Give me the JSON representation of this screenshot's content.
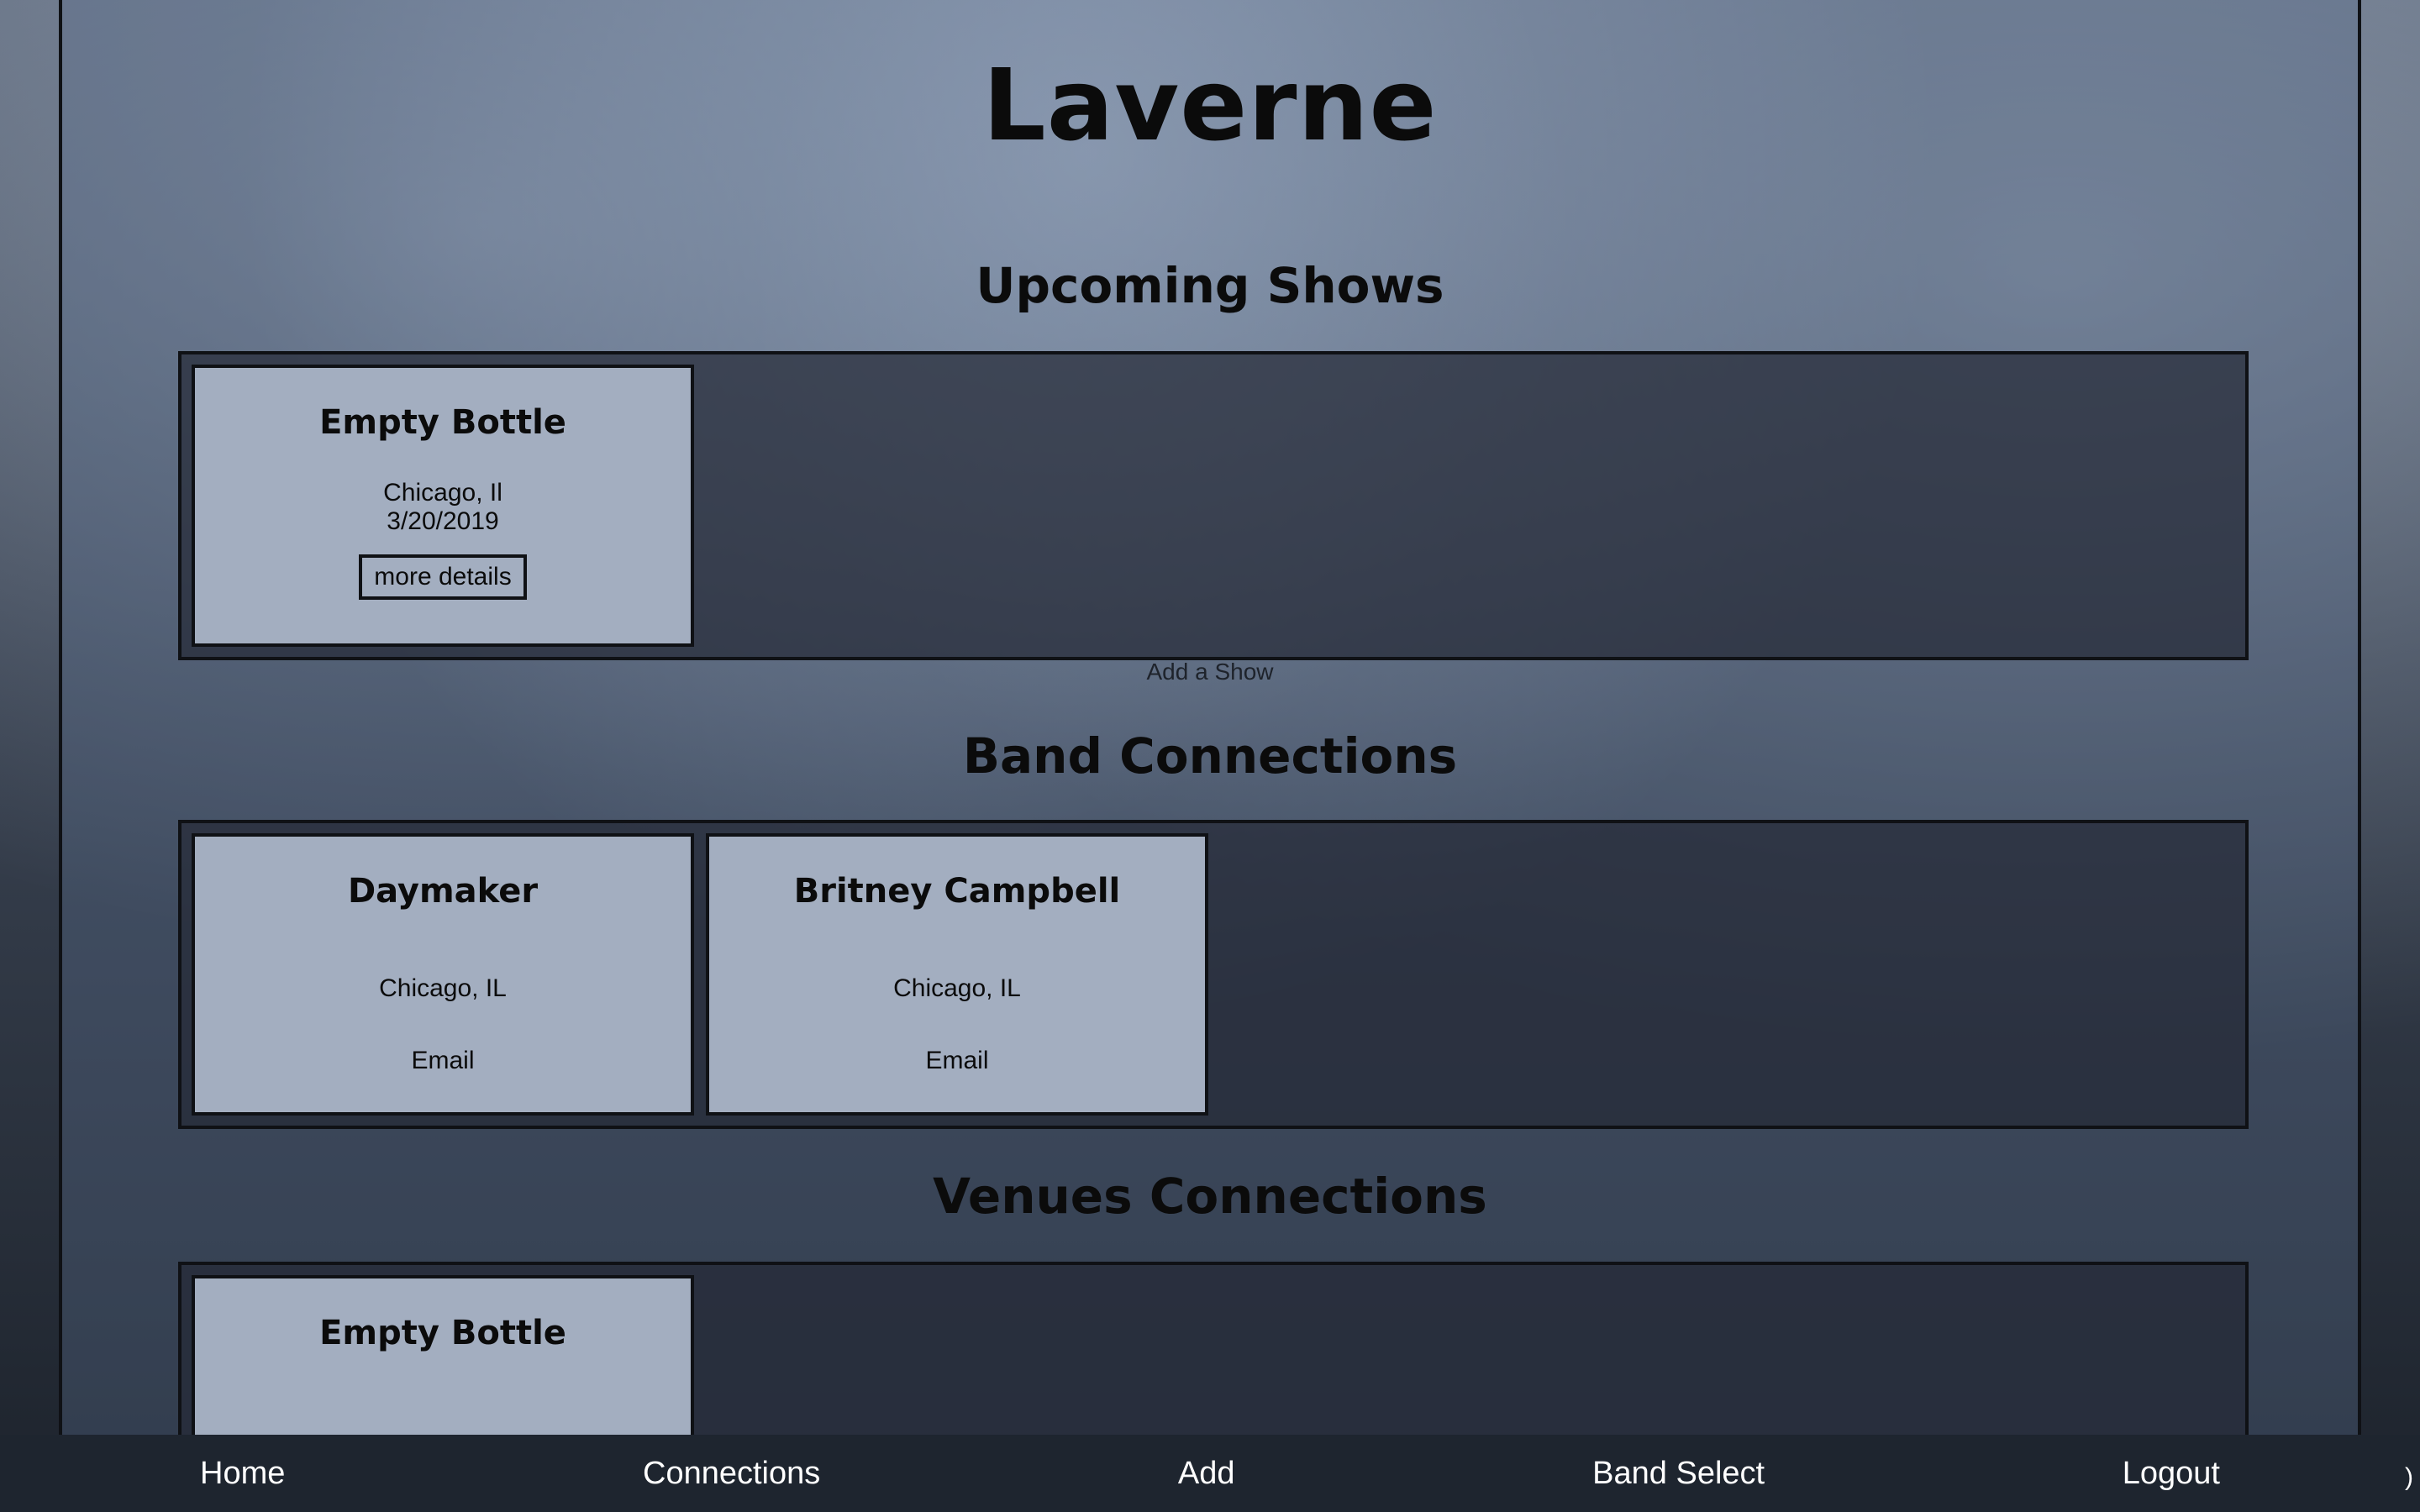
{
  "page": {
    "title": "Laverne",
    "sections": {
      "upcoming_shows": {
        "title": "Upcoming Shows",
        "cards": [
          {
            "title": "Empty Bottle",
            "location": "Chicago, Il",
            "date": "3/20/2019",
            "button_label": "more details"
          }
        ],
        "add_label": "Add a Show"
      },
      "band_connections": {
        "title": "Band Connections",
        "cards": [
          {
            "title": "Daymaker",
            "location": "Chicago, IL",
            "email_label": "Email"
          },
          {
            "title": "Britney Campbell",
            "location": "Chicago, IL",
            "email_label": "Email"
          }
        ]
      },
      "venues_connections": {
        "title": "Venues Connections",
        "cards": [
          {
            "title": "Empty Bottle"
          }
        ]
      }
    }
  },
  "nav": {
    "items": [
      "Home",
      "Connections",
      "Add",
      "Band Select",
      "Logout"
    ],
    "edge_glyph": ")"
  }
}
